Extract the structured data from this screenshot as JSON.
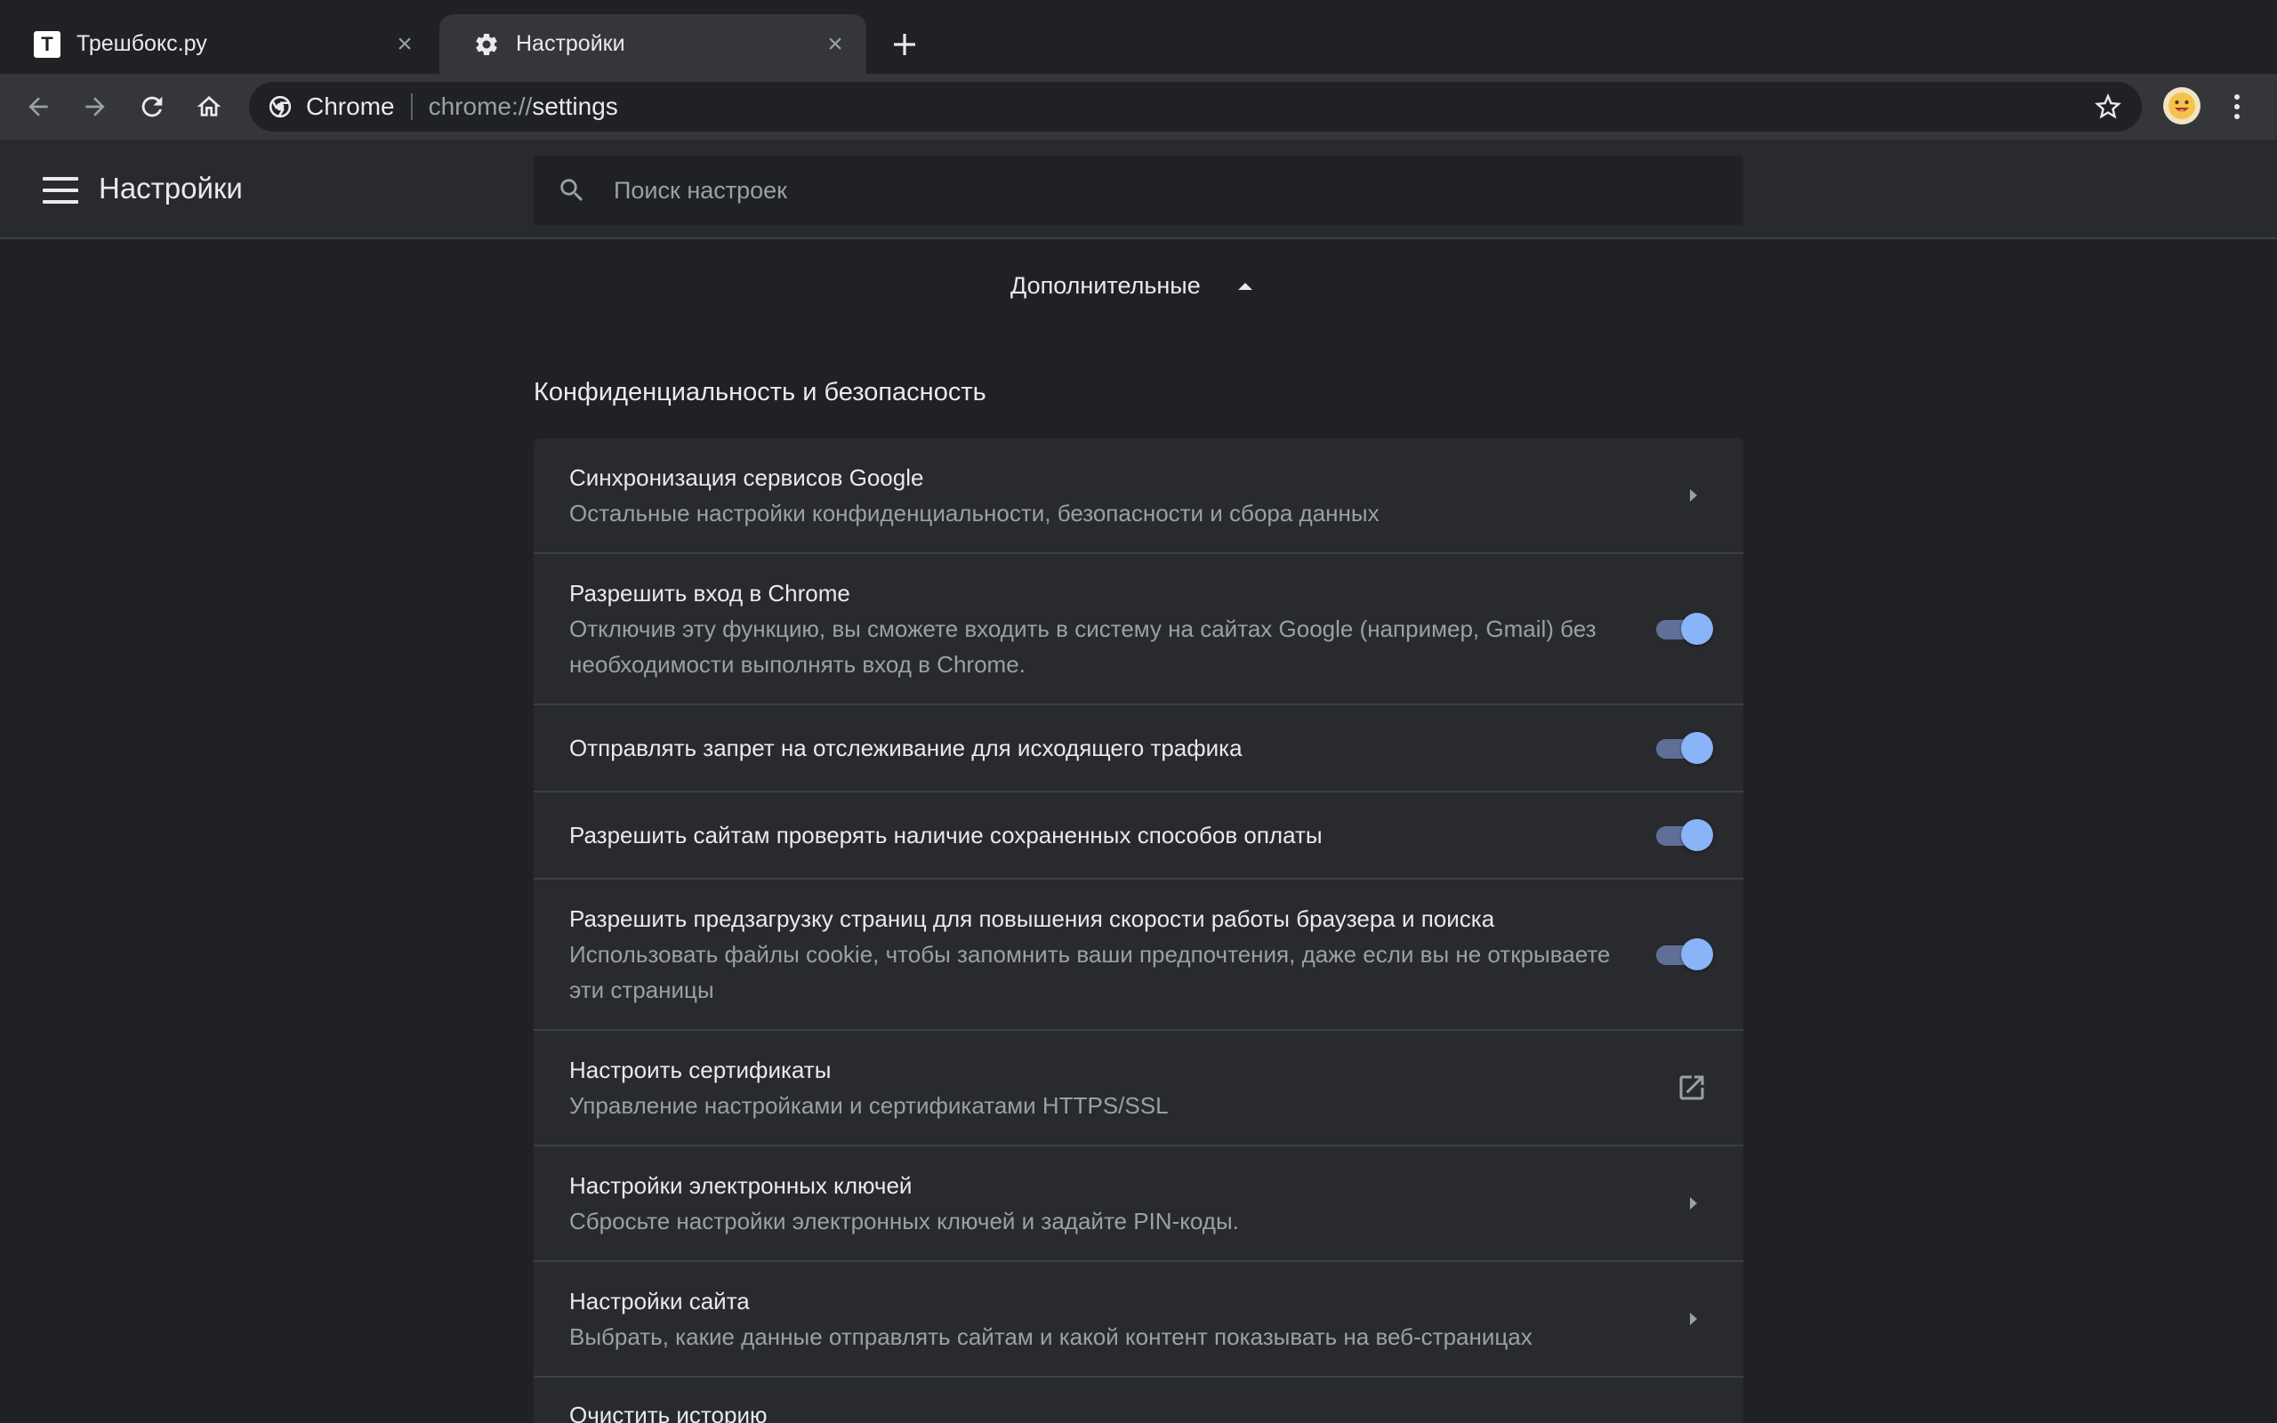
{
  "tabs": [
    {
      "title": "Трешбокс.ру",
      "favicon_letter": "T",
      "active": false
    },
    {
      "title": "Настройки",
      "active": true
    }
  ],
  "omnibox": {
    "chip": "Chrome",
    "scheme": "chrome://",
    "path": "settings"
  },
  "header": {
    "title": "Настройки",
    "search_placeholder": "Поиск настроек"
  },
  "advanced_label": "Дополнительные",
  "section_title": "Конфиденциальность и безопасность",
  "rows": [
    {
      "title": "Синхронизация сервисов Google",
      "sub": "Остальные настройки конфиденциальности, безопасности и сбора данных",
      "control": "chevron"
    },
    {
      "title": "Разрешить вход в Chrome",
      "sub": "Отключив эту функцию, вы сможете входить в систему на сайтах Google (например, Gmail) без необходимости выполнять вход в Chrome.",
      "control": "toggle",
      "on": true
    },
    {
      "title": "Отправлять запрет на отслеживание для исходящего трафика",
      "sub": "",
      "control": "toggle",
      "on": true
    },
    {
      "title": "Разрешить сайтам проверять наличие сохраненных способов оплаты",
      "sub": "",
      "control": "toggle",
      "on": true
    },
    {
      "title": "Разрешить предзагрузку страниц для повышения скорости работы браузера и поиска",
      "sub": "Использовать файлы cookie, чтобы запомнить ваши предпочтения, даже если вы не открываете эти страницы",
      "control": "toggle",
      "on": true
    },
    {
      "title": "Настроить сертификаты",
      "sub": "Управление настройками и сертификатами HTTPS/SSL",
      "control": "external"
    },
    {
      "title": "Настройки электронных ключей",
      "sub": "Сбросьте настройки электронных ключей и задайте PIN-коды.",
      "control": "chevron"
    },
    {
      "title": "Настройки сайта",
      "sub": "Выбрать, какие данные отправлять сайтам и какой контент показывать на веб-страницах",
      "control": "chevron"
    },
    {
      "title": "Очистить историю",
      "sub": "",
      "control": "none"
    }
  ],
  "colors": {
    "background": "#202124",
    "toolbar": "#35363a",
    "card": "#292a2d",
    "accent": "#8ab4f8"
  }
}
